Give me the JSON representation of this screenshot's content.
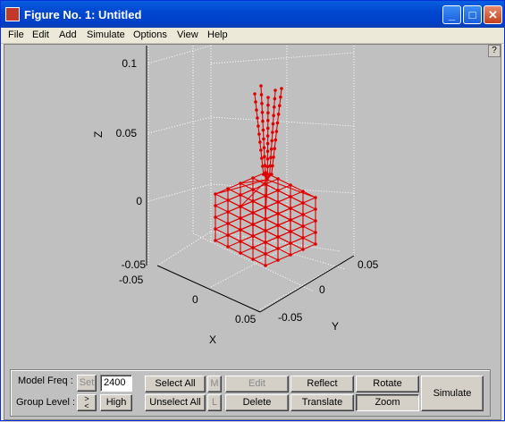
{
  "window": {
    "title": "Figure No. 1: Untitled",
    "help": "?"
  },
  "titlebar_buttons": {
    "minimize": "_",
    "maximize": "□",
    "close": "✕"
  },
  "menu": [
    "File",
    "Edit",
    "Add",
    "Simulate",
    "Options",
    "View",
    "Help"
  ],
  "axes": {
    "z_label": "Z",
    "x_label": "X",
    "y_label": "Y",
    "z_ticks": [
      "0.1",
      "0.05",
      "0",
      "-0.05"
    ],
    "x_ticks": [
      "-0.05",
      "0",
      "0.05"
    ],
    "y_ticks": [
      "0.05",
      "0",
      "-0.05"
    ]
  },
  "colors": {
    "model": "#e00000",
    "grid": "#ffffff"
  },
  "controls": {
    "model_freq_label": "Model Freq :",
    "set_label": "Set",
    "model_freq_value": "2400",
    "group_level_label": "Group Level :",
    "group_level_value": "High",
    "select_all": "Select All",
    "unselect_all": "Unselect All",
    "m_label": "M",
    "l_label": "L",
    "edit": "Edit",
    "delete": "Delete",
    "reflect": "Reflect",
    "translate": "Translate",
    "rotate": "Rotate",
    "zoom": "Zoom",
    "simulate": "Simulate"
  }
}
